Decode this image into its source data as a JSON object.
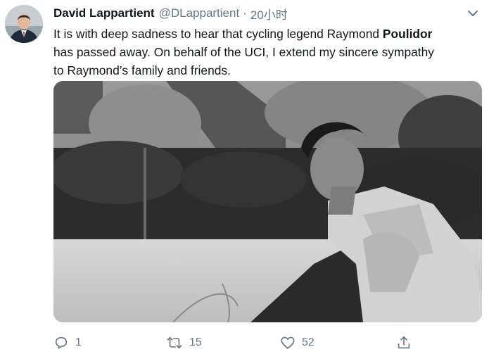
{
  "tweet": {
    "author_name": "David Lappartient",
    "author_handle": "@DLappartient",
    "separator": "·",
    "timestamp": "20小时",
    "text_line1": "It is with deep sadness to hear that cycling legend Raymond ",
    "text_bold": "Poulidor",
    "text_line2": " has passed away. On behalf of the UCI, I extend my sincere sympathy",
    "text_line3": "to Raymond’s family and friends.",
    "replies": "1",
    "retweets": "15",
    "likes": "52"
  },
  "icons": {
    "reply": "reply-icon",
    "retweet": "retweet-icon",
    "like": "like-icon",
    "share": "share-icon",
    "more": "chevron-down-icon"
  },
  "colors": {
    "text": "#14171a",
    "secondary": "#657786",
    "background": "#ffffff"
  }
}
